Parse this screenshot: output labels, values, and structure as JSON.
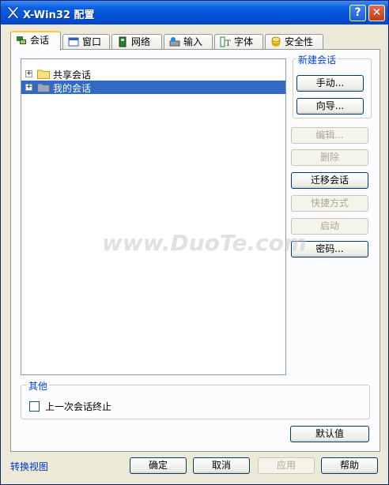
{
  "window": {
    "title": "X-Win32 配置",
    "help_glyph": "?",
    "close_glyph": "✕"
  },
  "tabs": [
    {
      "label": "会话",
      "icon": "sessions-icon",
      "active": true
    },
    {
      "label": "窗口",
      "icon": "window-icon"
    },
    {
      "label": "网络",
      "icon": "network-icon"
    },
    {
      "label": "输入",
      "icon": "input-icon"
    },
    {
      "label": "字体",
      "icon": "font-icon"
    },
    {
      "label": "安全性",
      "icon": "security-icon"
    }
  ],
  "tree": {
    "items": [
      {
        "label": "共享会话",
        "expander": "+",
        "selected": false
      },
      {
        "label": "我的会话",
        "expander": "+",
        "selected": true
      }
    ]
  },
  "new_session": {
    "title": "新建会话",
    "manual": "手动...",
    "wizard": "向导..."
  },
  "actions": {
    "edit": "编辑...",
    "delete": "删除",
    "migrate": "迁移会话",
    "shortcut": "快捷方式",
    "start": "启动",
    "password": "密码..."
  },
  "other": {
    "title": "其他",
    "last_session_checkbox": "上一次会话终止",
    "checked": false
  },
  "defaults_button": "默认值",
  "footer": {
    "switch_view": "转换视图",
    "ok": "确定",
    "cancel": "取消",
    "apply": "应用",
    "help": "帮助"
  },
  "watermark": "www.DuoTe.com",
  "colors": {
    "titlebar": "#0550d8",
    "selection": "#316ac5",
    "link": "#0033cc",
    "group_title": "#0046d5"
  }
}
